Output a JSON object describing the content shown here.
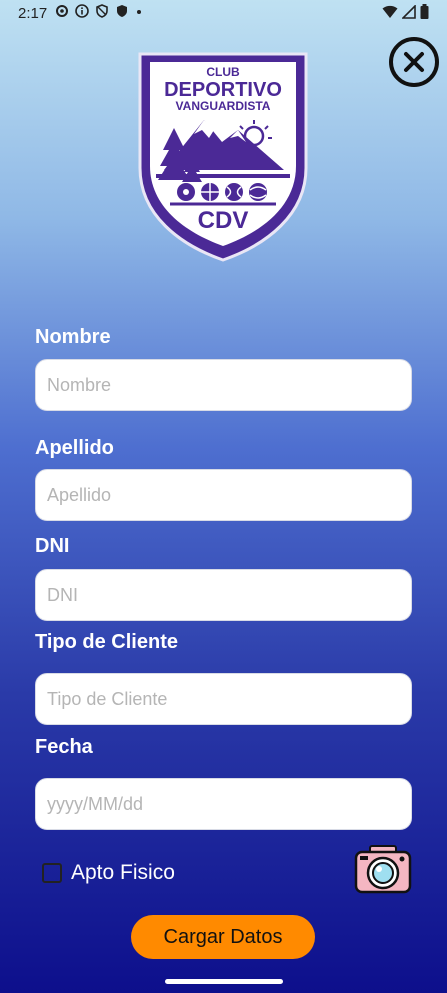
{
  "status": {
    "time": "2:17"
  },
  "logo": {
    "line1": "CLUB",
    "line2": "DEPORTIVO",
    "line3": "VANGUARDISTA",
    "initials": "CDV"
  },
  "form": {
    "fields": [
      {
        "label": "Nombre",
        "placeholder": "Nombre"
      },
      {
        "label": "Apellido",
        "placeholder": "Apellido"
      },
      {
        "label": "DNI",
        "placeholder": "DNI"
      },
      {
        "label": "Tipo de Cliente",
        "placeholder": "Tipo de Cliente"
      },
      {
        "label": "Fecha",
        "placeholder": "yyyy/MM/dd"
      }
    ],
    "apto_label": "Apto Fisico",
    "apto_checked": false,
    "submit_label": "Cargar Datos"
  },
  "icons": {
    "close": "close-icon",
    "camera": "camera-icon"
  },
  "colors": {
    "primary_purple": "#4b2996",
    "button_orange": "#ff8a00"
  }
}
